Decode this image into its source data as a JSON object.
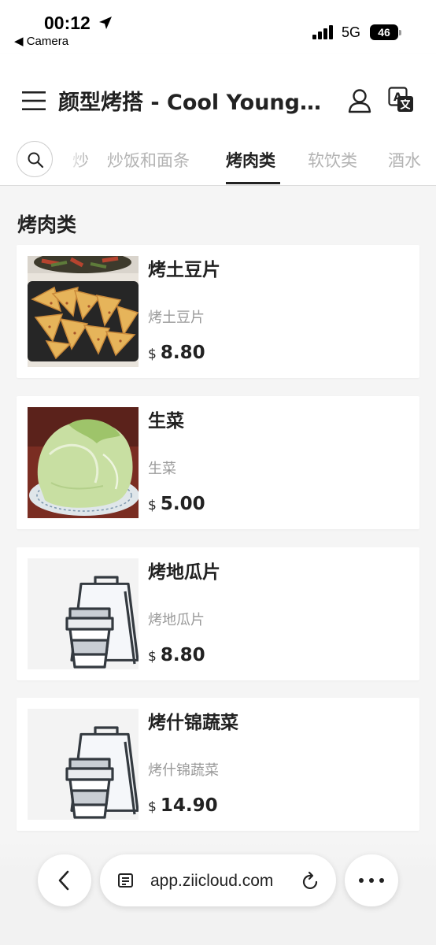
{
  "status_bar": {
    "time": "00:12",
    "back_label": "◀ Camera",
    "network": "5G",
    "battery": "46"
  },
  "header": {
    "title": "颜型烤搭 - Cool Young ..."
  },
  "categories": {
    "tabs": [
      {
        "label": "炒"
      },
      {
        "label": "炒饭和面条"
      },
      {
        "label": "烤肉类"
      },
      {
        "label": "软饮类"
      },
      {
        "label": "酒水"
      }
    ],
    "active_index": 2
  },
  "section": {
    "title": "烤肉类"
  },
  "products": [
    {
      "name": "烤土豆片",
      "description": "烤土豆片",
      "currency": "$",
      "price": "8.80",
      "image": "photo"
    },
    {
      "name": "生菜",
      "description": "生菜",
      "currency": "$",
      "price": "5.00",
      "image": "photo"
    },
    {
      "name": "烤地瓜片",
      "description": "烤地瓜片",
      "currency": "$",
      "price": "8.80",
      "image": "placeholder"
    },
    {
      "name": "烤什锦蔬菜",
      "description": "烤什锦蔬菜",
      "currency": "$",
      "price": "14.90",
      "image": "placeholder"
    }
  ],
  "browser": {
    "url": "app.ziicloud.com"
  },
  "icons": {
    "menu": "menu-icon",
    "user": "user-icon",
    "translate": "translate-icon",
    "search": "search-icon",
    "back": "chevron-left-icon",
    "reader": "reader-icon",
    "reload": "reload-icon",
    "more": "more-icon"
  },
  "colors": {
    "background": "#f5f5f5",
    "card": "#ffffff",
    "text": "#222222",
    "muted": "#9a9a9a",
    "inactive_tab": "#b3b3b3"
  }
}
